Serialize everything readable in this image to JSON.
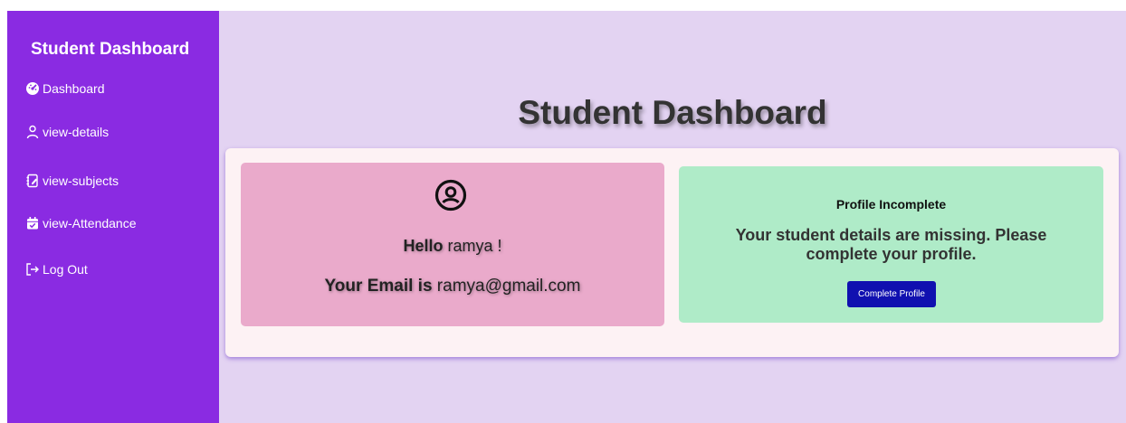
{
  "sidebar": {
    "title": "Student Dashboard",
    "items": [
      {
        "label": "Dashboard",
        "icon": "dashboard-icon"
      },
      {
        "label": "view-details",
        "icon": "user-icon"
      },
      {
        "label": "view-subjects",
        "icon": "notebook-edit-icon"
      },
      {
        "label": "view-Attendance",
        "icon": "calendar-check-icon"
      },
      {
        "label": "Log Out",
        "icon": "logout-icon"
      }
    ]
  },
  "main": {
    "title": "Student Dashboard",
    "user_card": {
      "icon": "user-circle-icon",
      "hello_prefix": "Hello",
      "user_name": "ramya !",
      "email_prefix": "Your Email is",
      "email": "ramya@gmail.com"
    },
    "profile_card": {
      "heading": "Profile Incomplete",
      "message": "Your student details are missing. Please complete your profile.",
      "button_label": "Complete Profile"
    }
  },
  "colors": {
    "sidebar_bg": "#8a2be2",
    "main_bg": "#e3d3f2",
    "user_card_bg": "#eaaacb",
    "profile_card_bg": "#afebc8",
    "button_bg": "#1010b0"
  }
}
